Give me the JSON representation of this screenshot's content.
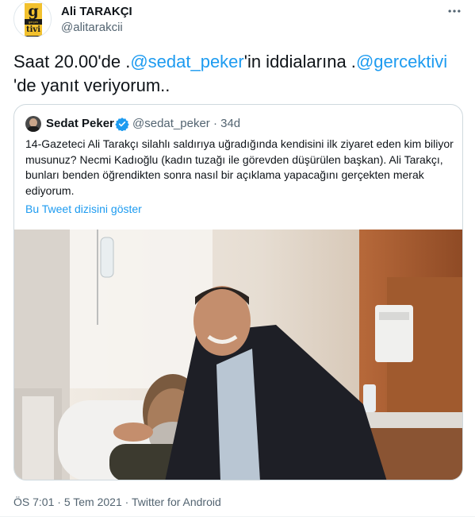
{
  "author": {
    "name": "Ali TARAKÇI",
    "handle": "@alitarakcii",
    "avatar_logo_letter": "g",
    "avatar_logo_mid": "gerçek",
    "avatar_logo_bottom": "tivi"
  },
  "tweet": {
    "text_before": "Saat 20.00'de .",
    "mention_1": "@sedat_peker",
    "text_mid": "'in iddialarına .",
    "mention_2": "@gercektivi",
    "text_after": "'de yanıt veriyorum.."
  },
  "quoted_tweet": {
    "name": "Sedat Peker",
    "handle_time": "@sedat_peker · 34d",
    "text": "14-Gazeteci Ali Tarakçı silahlı saldırıya uğradığında kendisini ilk ziyaret eden kim biliyor musunuz? Necmi Kadıoğlu (kadın tuzağı ile görevden düşürülen başkan). Ali Tarakçı, bunları benden öğrendikten sonra nasıl bir açıklama yapacağını gerçekten merak ediyorum.",
    "show_thread": "Bu Tweet dizisini göster"
  },
  "footer": {
    "time": "ÖS 7:01",
    "date": "5 Tem 2021",
    "source": "Twitter for Android",
    "separator": " · "
  },
  "colors": {
    "link": "#1d9bf0",
    "text": "#0f1419",
    "secondary": "#536471",
    "border": "#cfd9de"
  },
  "icons": {
    "more": "more-horizontal-icon",
    "verified": "verified-badge-icon"
  }
}
